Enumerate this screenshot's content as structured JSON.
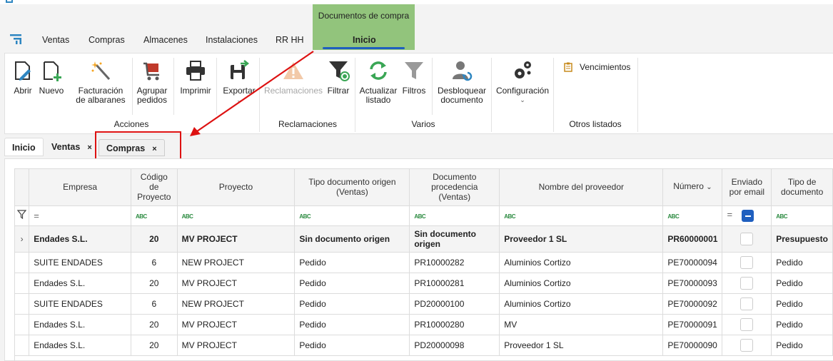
{
  "context_tab": {
    "label": "Documentos de compra"
  },
  "menu": {
    "items": [
      "Ventas",
      "Compras",
      "Almacenes",
      "Instalaciones",
      "RR HH"
    ],
    "active": "Inicio"
  },
  "ribbon": {
    "groups": {
      "acciones": "Acciones",
      "reclamaciones": "Reclamaciones",
      "varios": "Varios",
      "otros": "Otros listados"
    },
    "buttons": {
      "abrir": "Abrir",
      "nuevo": "Nuevo",
      "facturacion_1": "Facturación",
      "facturacion_2": "de albaranes",
      "agrupar_1": "Agrupar",
      "agrupar_2": "pedidos",
      "imprimir": "Imprimir",
      "exportar": "Exportar",
      "reclamaciones": "Reclamaciones",
      "filtrar": "Filtrar",
      "actualizar_1": "Actualizar",
      "actualizar_2": "listado",
      "filtros": "Filtros",
      "desbloquear_1": "Desbloquear",
      "desbloquear_2": "documento",
      "configuracion": "Configuración",
      "vencimientos": "Vencimientos"
    }
  },
  "tabs": {
    "inicio": "Inicio",
    "ventas": "Ventas",
    "compras": "Compras",
    "close": "×"
  },
  "grid": {
    "headers": {
      "empresa": "Empresa",
      "codigo_proyecto": "Código de Proyecto",
      "proyecto": "Proyecto",
      "tipo_doc_origen": "Tipo documento origen (Ventas)",
      "doc_procedencia": "Documento procedencia (Ventas)",
      "proveedor": "Nombre del proveedor",
      "numero": "Número",
      "enviado": "Enviado por email",
      "tipo_doc": "Tipo de documento"
    },
    "filter_eq": "=",
    "filter_abc": "ABC",
    "group_row": {
      "empresa": "Endades S.L.",
      "codigo": "20",
      "proyecto": "MV PROJECT",
      "tipo_origen": "Sin documento origen",
      "procedencia": "Sin documento origen",
      "proveedor": "Proveedor 1 SL",
      "numero": "PR60000001",
      "tipo": "Presupuesto"
    },
    "rows": [
      {
        "empresa": "SUITE ENDADES",
        "codigo": "6",
        "proyecto": "NEW PROJECT",
        "tipo_origen": "Pedido",
        "procedencia": "PR10000282",
        "proveedor": "Aluminios Cortizo",
        "numero": "PE70000094",
        "tipo": "Pedido"
      },
      {
        "empresa": "Endades S.L.",
        "codigo": "20",
        "proyecto": "MV PROJECT",
        "tipo_origen": "Pedido",
        "procedencia": "PR10000281",
        "proveedor": "Aluminios Cortizo",
        "numero": "PE70000093",
        "tipo": "Pedido"
      },
      {
        "empresa": "SUITE ENDADES",
        "codigo": "6",
        "proyecto": "NEW PROJECT",
        "tipo_origen": "Pedido",
        "procedencia": "PD20000100",
        "proveedor": "Aluminios Cortizo",
        "numero": "PE70000092",
        "tipo": "Pedido"
      },
      {
        "empresa": "Endades S.L.",
        "codigo": "20",
        "proyecto": "MV PROJECT",
        "tipo_origen": "Pedido",
        "procedencia": "PR10000280",
        "proveedor": "MV",
        "numero": "PE70000091",
        "tipo": "Pedido"
      },
      {
        "empresa": "Endades S.L.",
        "codigo": "20",
        "proyecto": "MV PROJECT",
        "tipo_origen": "Pedido",
        "procedencia": "PD20000098",
        "proveedor": "Proveedor 1 SL",
        "numero": "PE70000090",
        "tipo": "Pedido"
      }
    ]
  },
  "colors": {
    "context": "#92c47c",
    "accent": "#1f5fbf",
    "annotation": "#dd1111"
  }
}
